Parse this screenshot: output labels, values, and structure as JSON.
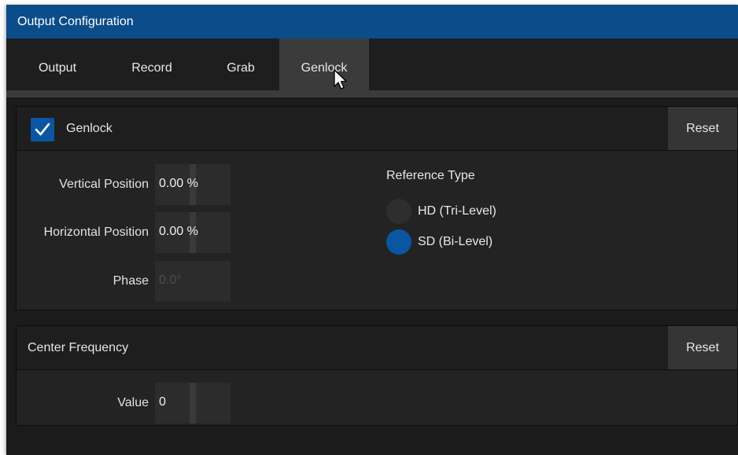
{
  "window": {
    "title": "Output Configuration"
  },
  "tabs": [
    {
      "label": "Output",
      "active": false
    },
    {
      "label": "Record",
      "active": false
    },
    {
      "label": "Grab",
      "active": false
    },
    {
      "label": "Genlock",
      "active": true
    }
  ],
  "genlock_panel": {
    "checkbox_label": "Genlock",
    "checked": true,
    "reset_label": "Reset",
    "fields": [
      {
        "label": "Vertical Position",
        "value": "0.00 %",
        "enabled": true
      },
      {
        "label": "Horizontal Position",
        "value": "0.00 %",
        "enabled": true
      },
      {
        "label": "Phase",
        "value": "0.0°",
        "enabled": false
      }
    ],
    "reference_type": {
      "heading": "Reference Type",
      "options": [
        {
          "label": "HD (Tri-Level)",
          "selected": false
        },
        {
          "label": "SD (Bi-Level)",
          "selected": true
        }
      ]
    }
  },
  "center_frequency_panel": {
    "title": "Center Frequency",
    "reset_label": "Reset",
    "value_label": "Value",
    "value": "0"
  },
  "colors": {
    "titlebar": "#0b4c8a",
    "accent": "#0a56a3",
    "background": "#1b1b1b",
    "panel": "#232323"
  }
}
